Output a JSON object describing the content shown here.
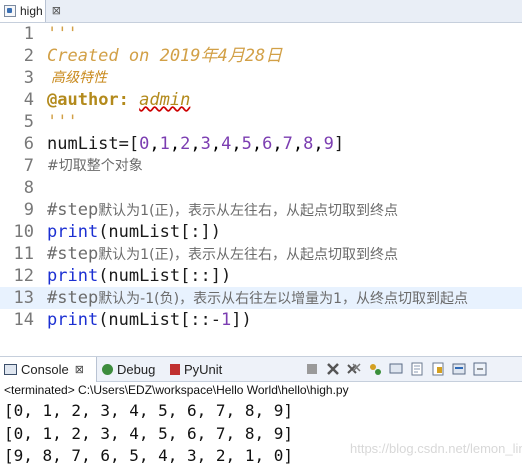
{
  "editor": {
    "tab_label": "high",
    "tab_close": "⊠",
    "lines": [
      {
        "num": "1"
      },
      {
        "num": "2"
      },
      {
        "num": "3"
      },
      {
        "num": "4"
      },
      {
        "num": "5"
      },
      {
        "num": "6"
      },
      {
        "num": "7"
      },
      {
        "num": "8"
      },
      {
        "num": "9"
      },
      {
        "num": "10"
      },
      {
        "num": "11"
      },
      {
        "num": "12"
      },
      {
        "num": "13"
      },
      {
        "num": "14"
      }
    ],
    "code": {
      "l1": "'''",
      "l2": "Created on 2019年4月28日",
      "l3": "高级特性",
      "l4_at": "@",
      "l4_author": "author:",
      "l4_admin": "admin",
      "l5": "'''",
      "l6_name": "numList",
      "l6_eq": "=[",
      "l6_nums": [
        "0",
        "1",
        "2",
        "3",
        "4",
        "5",
        "6",
        "7",
        "8",
        "9"
      ],
      "l6_close": "]",
      "l7": "#切取整个对象",
      "l9_hash": "#step",
      "l9_text": "默认为1(正)，表示从左往右，从起点切取到终点",
      "l10_kw": "print",
      "l10_rest": "(numList[:])",
      "l11_hash": "#step",
      "l11_text": "默认为1(正)，表示从左往右，从起点切取到终点",
      "l12_kw": "print",
      "l12_rest": "(numList[::])",
      "l13_hash": "#step",
      "l13_text": "默认为-1(负)，表示从右往左以增量为1，从终点切取到起点",
      "l14_kw": "print",
      "l14_rest_a": "(numList[::-",
      "l14_num": "1",
      "l14_rest_b": "])"
    }
  },
  "console": {
    "tabs": {
      "console": "Console",
      "debug": "Debug",
      "pyunit": "PyUnit"
    },
    "close_glyph": "⊠",
    "status": "<terminated> C:\\Users\\EDZ\\workspace\\Hello World\\hello\\high.py",
    "output": [
      "[0, 1, 2, 3, 4, 5, 6, 7, 8, 9]",
      "[0, 1, 2, 3, 4, 5, 6, 7, 8, 9]",
      "[9, 8, 7, 6, 5, 4, 3, 2, 1, 0]"
    ],
    "toolbar_icons": [
      "stop-icon",
      "remove-launch-icon",
      "remove-all-icon",
      "pin-icon",
      "display-icon",
      "clear-icon",
      "scroll-lock-icon",
      "word-wrap-icon",
      "open-console-icon",
      "minimize-icon"
    ]
  },
  "watermark": "https://blog.csdn.net/lemon_linaa",
  "colors": {
    "keyword": "#1b2fd2",
    "number": "#7b3db1",
    "docstring": "#d2a047",
    "comment": "#6b6b6b",
    "current_line": "#e8f2fe"
  }
}
